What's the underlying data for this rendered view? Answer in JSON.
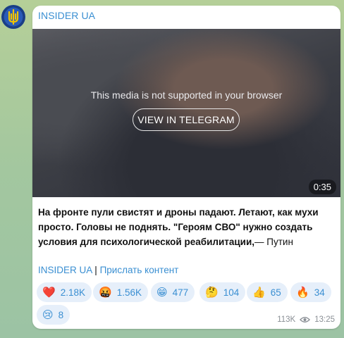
{
  "channel": {
    "name": "INSIDER UA"
  },
  "media": {
    "unsupported_message": "This media is not supported in your browser",
    "view_button_label": "VIEW IN TELEGRAM",
    "duration": "0:35"
  },
  "post": {
    "bold_text": "На фронте пули свистят и дроны падают. Летают, как мухи просто. Головы не поднять. \"Героям СВО\" нужно создать условия для психологической реабилитации,",
    "attribution": "— Путин",
    "link_channel": "INSIDER UA",
    "separator": "|",
    "link_submit": "Прислать контент"
  },
  "reactions": [
    {
      "emoji": "❤️",
      "icon": "heart-icon",
      "count": "2.18K"
    },
    {
      "emoji": "🤬",
      "icon": "angry-face-icon",
      "count": "1.56K"
    },
    {
      "emoji": "😁",
      "icon": "grin-face-icon",
      "count": "477"
    },
    {
      "emoji": "🤔",
      "icon": "thinking-face-icon",
      "count": "104"
    },
    {
      "emoji": "👍",
      "icon": "thumbs-up-icon",
      "count": "65"
    },
    {
      "emoji": "🔥",
      "icon": "fire-icon",
      "count": "34"
    },
    {
      "emoji": "😢",
      "icon": "crying-face-icon",
      "count": "8"
    }
  ],
  "meta": {
    "views": "113K",
    "time": "13:25"
  },
  "colors": {
    "link": "#3a8fd2",
    "reaction_bg": "#e6effa",
    "bubble": "#ffffff"
  }
}
